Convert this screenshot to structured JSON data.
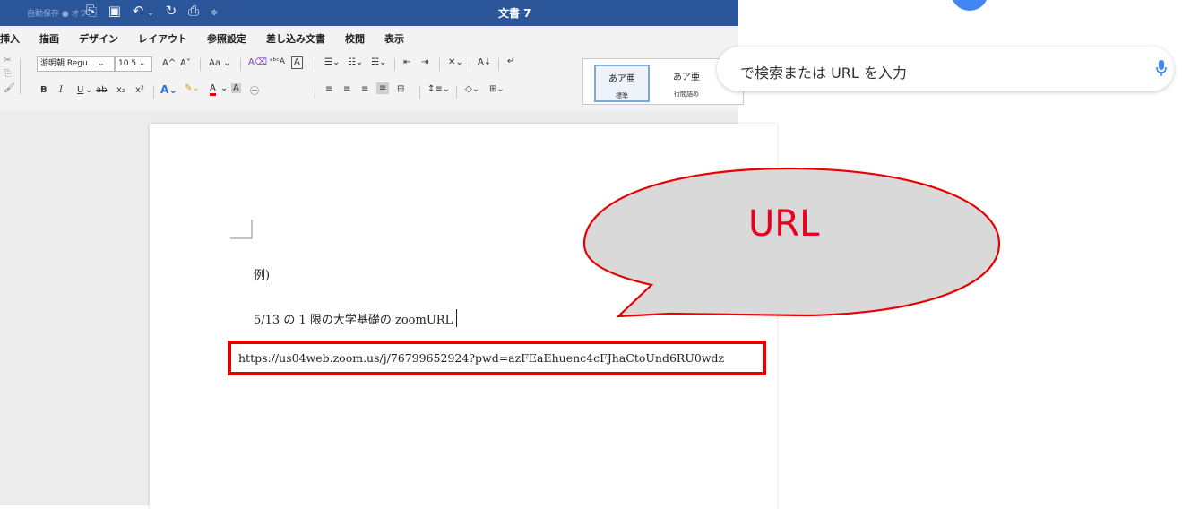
{
  "word": {
    "titlebar": {
      "autosave_label": "自動保存 ● オフ",
      "qat_icons": [
        "new-doc-icon",
        "save-icon",
        "undo-icon",
        "redo-icon",
        "print-icon",
        "customize-icon"
      ],
      "document_title": "文書 7"
    },
    "tabs": [
      "挿入",
      "描画",
      "デザイン",
      "レイアウト",
      "参照設定",
      "差し込み文書",
      "校閲",
      "表示"
    ],
    "ribbon": {
      "font_name": "游明朝 Regu...",
      "font_size": "10.5",
      "font_grow": "A^",
      "font_shrink": "A˅",
      "change_case": "Aa",
      "bold": "B",
      "italic": "I",
      "underline": "U",
      "strikethrough": "ab",
      "subscript": "x₂",
      "superscript": "x²",
      "sort": "A↓",
      "styles": [
        {
          "preview": "あア亜",
          "name": "標準"
        },
        {
          "preview": "あア亜",
          "name": "行間詰め"
        }
      ]
    },
    "document": {
      "line1": "例)",
      "line2": "5/13 の 1 限の大学基礎の zoomURL",
      "url_line": "https://us04web.zoom.us/j/76799652924?pwd=azFEaEhuenc4cFJhaCtoUnd6RU0wdz"
    }
  },
  "browser": {
    "search_placeholder": "で検索または URL を入力",
    "mic_icon": "mic-icon"
  },
  "annotation": {
    "bubble_text": "URL",
    "highlight_color": "#e60000",
    "bubble_fill": "#d9d9d9"
  },
  "colors": {
    "word_titlebar": "#2b579a",
    "ribbon_bg": "#f3f3f3",
    "google_blue": "#4285f4"
  }
}
